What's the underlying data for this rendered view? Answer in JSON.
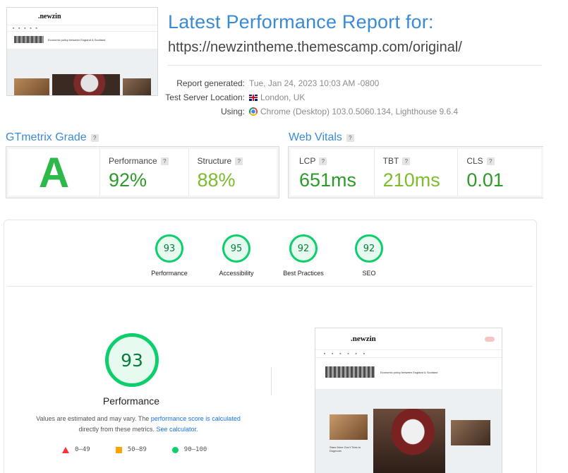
{
  "thumbnail": {
    "logo": ".newzin",
    "headline": "Economic policy between England & Scotland"
  },
  "header": {
    "title": "Latest Performance Report for:",
    "url": "https://newzintheme.themescamp.com/original/"
  },
  "meta": {
    "report_label": "Report generated:",
    "report_value": "Tue, Jan 24, 2023 10:03 AM -0800",
    "location_label": "Test Server Location:",
    "location_value": "London, UK",
    "using_label": "Using:",
    "using_value": "Chrome (Desktop) 103.0.5060.134, Lighthouse 9.6.4"
  },
  "grade": {
    "title": "GTmetrix Grade",
    "letter": "A",
    "performance_label": "Performance",
    "performance_value": "92%",
    "structure_label": "Structure",
    "structure_value": "88%"
  },
  "vitals": {
    "title": "Web Vitals",
    "lcp_label": "LCP",
    "lcp_value": "651ms",
    "tbt_label": "TBT",
    "tbt_value": "210ms",
    "cls_label": "CLS",
    "cls_value": "0.01"
  },
  "help": "?",
  "lighthouse": {
    "gauges": [
      {
        "label": "Performance",
        "score": "93"
      },
      {
        "label": "Accessibility",
        "score": "95"
      },
      {
        "label": "Best Practices",
        "score": "92"
      },
      {
        "label": "SEO",
        "score": "92"
      }
    ],
    "main_score": "93",
    "main_label": "Performance",
    "desc_prefix": "Values are estimated and may vary. The ",
    "desc_link1": "performance score is calculated",
    "desc_middle": "directly from these metrics. ",
    "desc_link2": "See calculator.",
    "legend": [
      {
        "range": "0–49"
      },
      {
        "range": "50–89"
      },
      {
        "range": "90–100"
      }
    ]
  },
  "colors": {
    "accent": "#3a8bd6",
    "grade_green": "#2db84a",
    "pass": "#0cce6b",
    "average": "#ffa400",
    "fail": "#ff3333"
  },
  "screenshot": {
    "logo": ".newzin",
    "headline": "Economic policy between England & Scotland",
    "caption": "Stars More Gov't Tries to Dogecoin"
  }
}
